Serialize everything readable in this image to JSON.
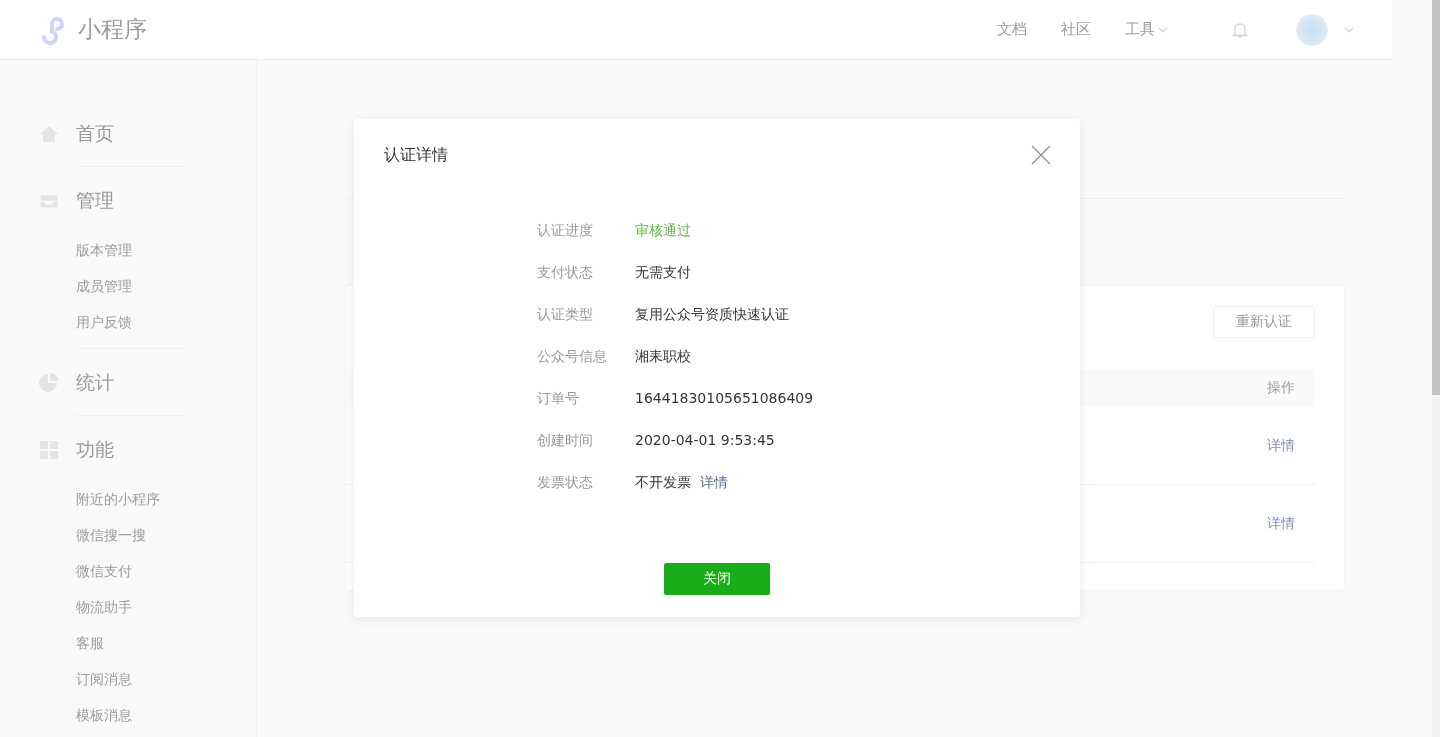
{
  "header": {
    "logo_text": "小程序",
    "nav": [
      {
        "label": "文档",
        "kind": "link"
      },
      {
        "label": "社区",
        "kind": "link"
      },
      {
        "label": "工具",
        "kind": "dropdown"
      }
    ]
  },
  "sidebar": {
    "sections": [
      {
        "label": "首页"
      },
      {
        "label": "管理",
        "items": [
          "版本管理",
          "成员管理",
          "用户反馈"
        ]
      },
      {
        "label": "统计"
      },
      {
        "label": "功能",
        "items": [
          "附近的小程序",
          "微信搜一搜",
          "微信支付",
          "物流助手",
          "客服",
          "订阅消息",
          "模板消息"
        ]
      }
    ]
  },
  "page": {
    "card": {
      "button": "重新认证",
      "table": {
        "columns": [
          {
            "label": "操作"
          }
        ],
        "rows": [
          {
            "action": "详情"
          },
          {
            "action": "详情"
          }
        ]
      }
    }
  },
  "modal": {
    "title": "认证详情",
    "rows": [
      {
        "label": "认证进度",
        "value": "审核通过",
        "kind": "success"
      },
      {
        "label": "支付状态",
        "value": "无需支付",
        "kind": "plain"
      },
      {
        "label": "认证类型",
        "value": "复用公众号资质快速认证",
        "kind": "plain"
      },
      {
        "label": "公众号信息",
        "value": "湘耒职校",
        "kind": "plain"
      },
      {
        "label": "订单号",
        "value": "16441830105651086409",
        "kind": "plain"
      },
      {
        "label": "创建时间",
        "value": "2020-04-01 9:53:45",
        "kind": "plain"
      },
      {
        "label": "发票状态",
        "value": "不开发票",
        "kind": "plain",
        "link": "详情"
      }
    ],
    "close_button": "关闭"
  }
}
